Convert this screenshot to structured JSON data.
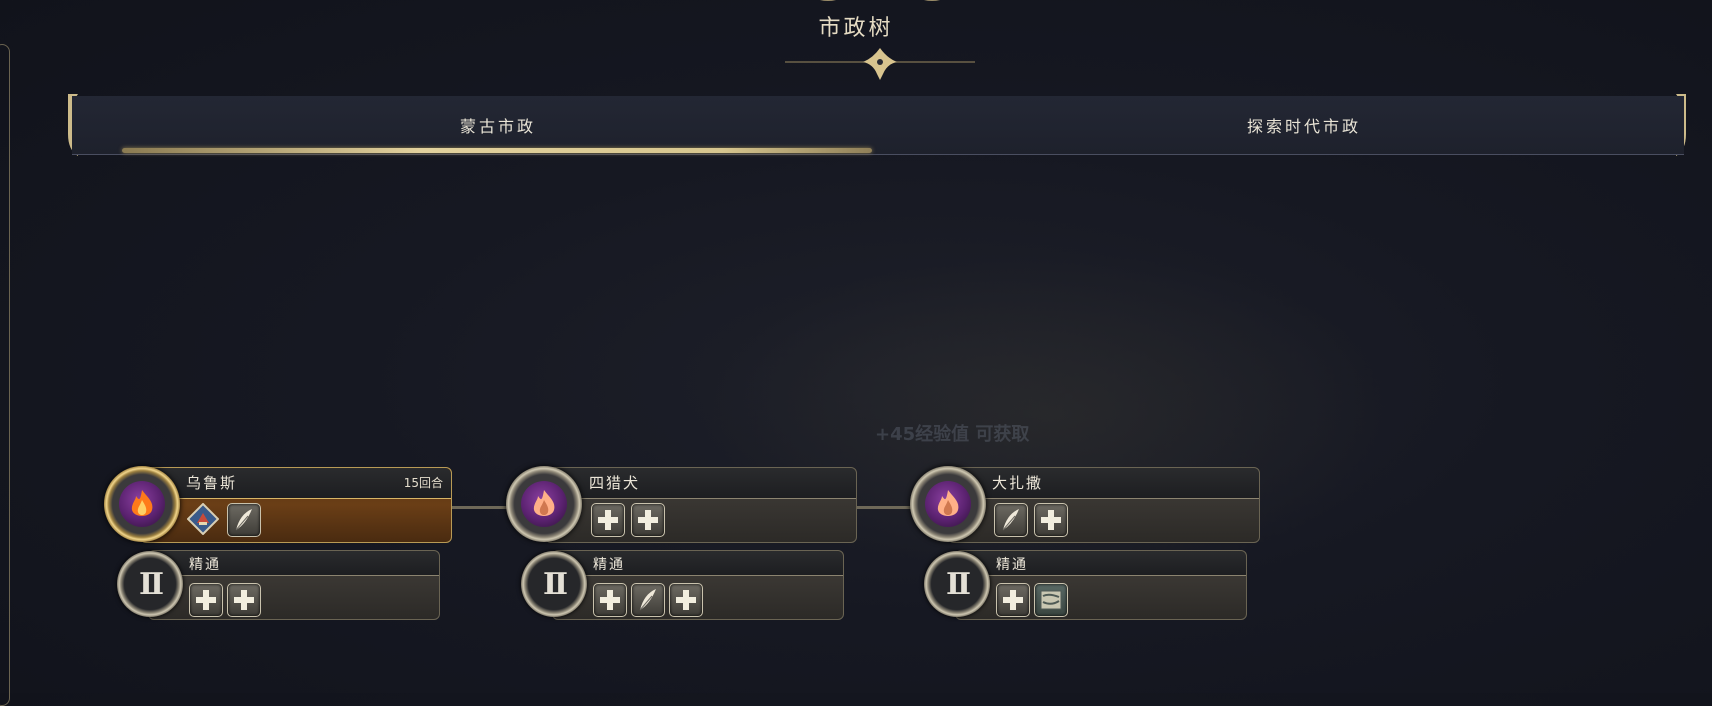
{
  "header": {
    "title": "市政树"
  },
  "tabs": [
    {
      "label": "蒙古市政",
      "active": true
    },
    {
      "label": "探索时代市政",
      "active": false
    }
  ],
  "map_overlay": {
    "text": "+45经验值 可获取"
  },
  "nodes": [
    {
      "name": "乌鲁斯",
      "turns": "15回合",
      "state": "researching",
      "unlocks": [
        "diamond-unit-icon",
        "quill-icon"
      ],
      "mastery": {
        "label": "精通",
        "numeral": "II",
        "unlocks": [
          "plus-icon",
          "plus-icon"
        ]
      }
    },
    {
      "name": "四猎犬",
      "turns": "",
      "state": "locked",
      "unlocks": [
        "plus-icon",
        "plus-icon"
      ],
      "mastery": {
        "label": "精通",
        "numeral": "II",
        "unlocks": [
          "plus-icon",
          "quill-icon",
          "plus-icon"
        ]
      }
    },
    {
      "name": "大扎撒",
      "turns": "",
      "state": "locked",
      "unlocks": [
        "quill-icon",
        "plus-icon"
      ],
      "mastery": {
        "label": "精通",
        "numeral": "II",
        "unlocks": [
          "plus-icon",
          "map-icon"
        ]
      }
    }
  ],
  "colors": {
    "accent_gold": "#d8c48e",
    "active_panel": "#6a3e16",
    "background": "#161822"
  }
}
